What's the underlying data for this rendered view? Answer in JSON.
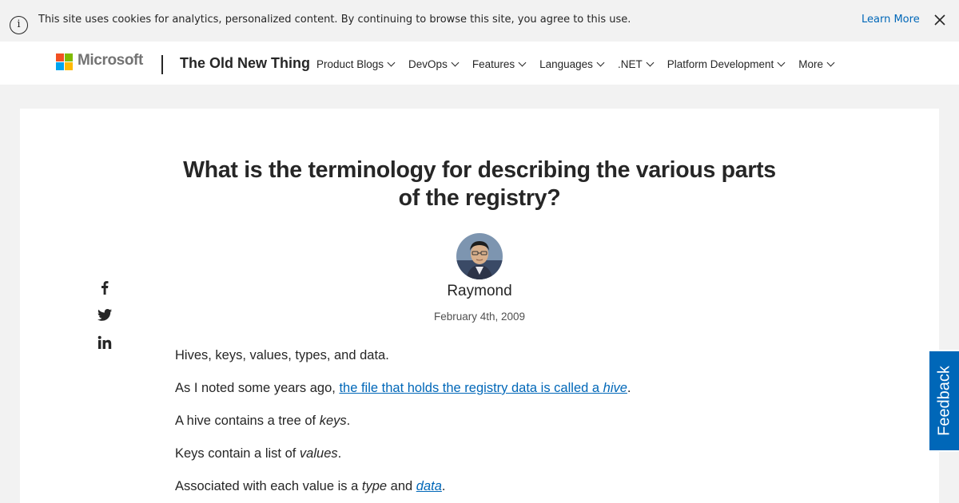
{
  "cookie_banner": {
    "message": "This site uses cookies for analytics, personalized content. By continuing to browse this site, you agree to this use.",
    "learn_more": "Learn More"
  },
  "header": {
    "logo_text": "Microsoft",
    "site_title": "The Old New Thing",
    "nav": [
      {
        "label": "Product Blogs"
      },
      {
        "label": "DevOps"
      },
      {
        "label": "Features"
      },
      {
        "label": "Languages"
      },
      {
        "label": ".NET"
      },
      {
        "label": "Platform Development"
      },
      {
        "label": "More"
      }
    ]
  },
  "article": {
    "title": "What is the terminology for describing the various parts of the registry?",
    "author": "Raymond",
    "date": "February 4th, 2009",
    "paragraphs": {
      "p1": "Hives, keys, values, types, and data.",
      "p2_prefix": "As I noted some years ago, ",
      "p2_link": "the file that holds the registry data is called a ",
      "p2_link_em": "hive",
      "p2_suffix": ".",
      "p3_prefix": "A hive contains a tree of ",
      "p3_em": "keys",
      "p3_suffix": ".",
      "p4_prefix": "Keys contain a list of ",
      "p4_em": "values",
      "p4_suffix": ".",
      "p5_prefix": "Associated with each value is a ",
      "p5_em": "type",
      "p5_mid": " and ",
      "p5_link_em": "data",
      "p5_suffix": "."
    }
  },
  "share": {
    "icons": [
      "facebook-icon",
      "twitter-icon",
      "linkedin-icon"
    ]
  },
  "feedback_label": "Feedback",
  "colors": {
    "accent": "#0067b8",
    "text": "#262626",
    "page_bg": "#f2f2f2"
  }
}
